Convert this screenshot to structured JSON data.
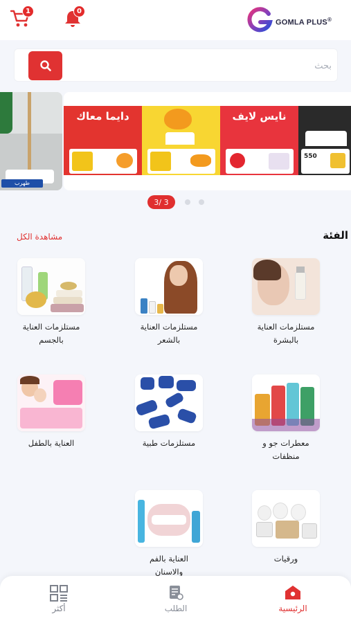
{
  "header": {
    "cart_count": "1",
    "notifications_count": "0",
    "logo_text": "GOMLA PLUS",
    "logo_mark": "®"
  },
  "search": {
    "placeholder": "بحث"
  },
  "banner": {
    "panels": [
      "دايما معاك",
      "",
      "نايس لايف",
      ""
    ],
    "left_caption": "طهرب",
    "box_count_text": "550",
    "pagination": {
      "current": "3",
      "total": "3",
      "text": "3/ 3"
    }
  },
  "categories_section": {
    "title": "الفئة",
    "view_all": "مشاهدة الكل"
  },
  "categories": [
    {
      "label_line1": "مستلزمات العناية",
      "label_line2": "بالبشرة"
    },
    {
      "label_line1": "مستلزمات العناية",
      "label_line2": "بالشعر"
    },
    {
      "label_line1": "مستلزمات العناية",
      "label_line2": "بالجسم"
    },
    {
      "label_line1": "معطرات جو و",
      "label_line2": "منظفات"
    },
    {
      "label_line1": "مستلزمات طبية",
      "label_line2": ""
    },
    {
      "label_line1": "العناية بالطفل",
      "label_line2": ""
    },
    {
      "label_line1": "ورقيات",
      "label_line2": ""
    },
    {
      "label_line1": "العناية بالفم",
      "label_line2": "والاسنان"
    }
  ],
  "bottom_nav": {
    "home": "الرئيسية",
    "orders": "الطلب",
    "more": "أكثر"
  },
  "colors": {
    "accent": "#e03232",
    "background": "#f4f6fb"
  },
  "icons": [
    "cart-icon",
    "bell-icon",
    "search-icon",
    "home-icon",
    "orders-icon",
    "grid-icon"
  ]
}
